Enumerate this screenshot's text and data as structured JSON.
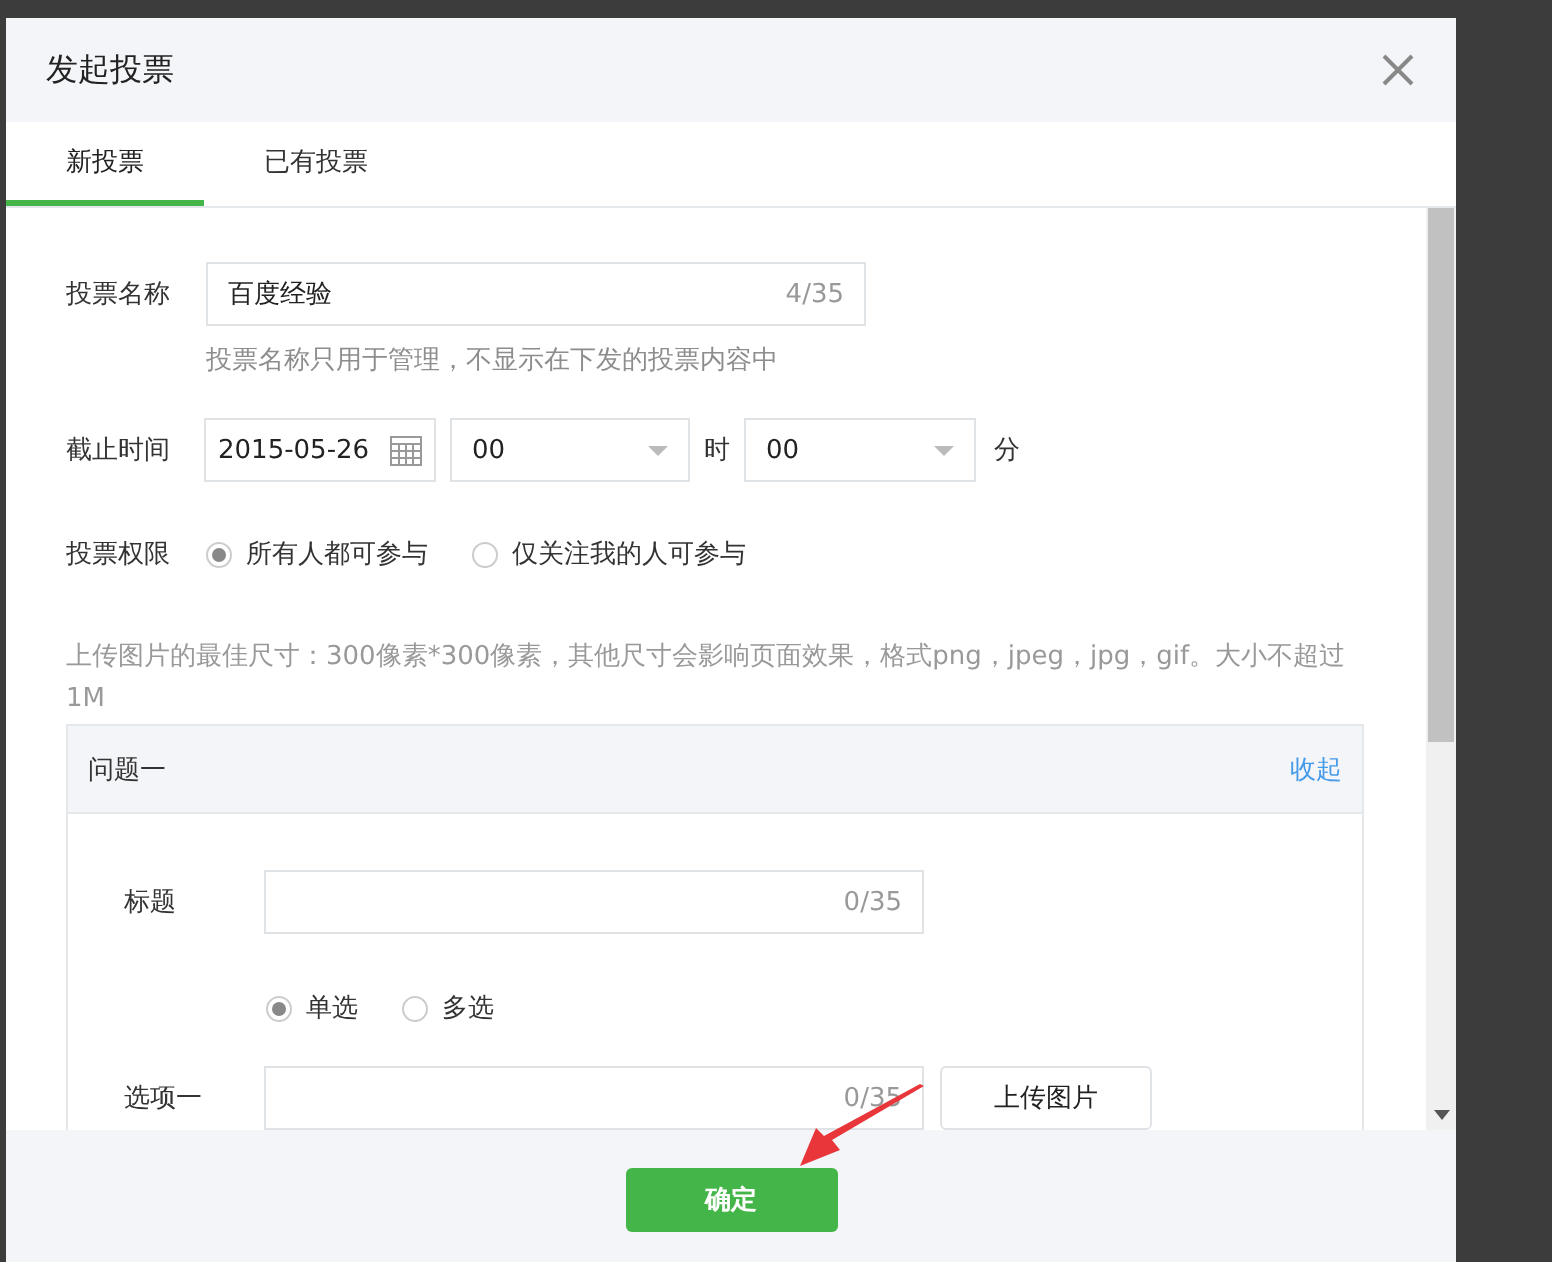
{
  "dialog": {
    "title": "发起投票"
  },
  "tabs": [
    {
      "label": "新投票",
      "selected": true
    },
    {
      "label": "已有投票",
      "selected": false
    }
  ],
  "vote_name": {
    "label": "投票名称",
    "value": "百度经验",
    "counter": "4/35",
    "hint": "投票名称只用于管理，不显示在下发的投票内容中"
  },
  "deadline": {
    "label": "截止时间",
    "date": "2015-05-26",
    "hour": "00",
    "hour_unit": "时",
    "minute": "00",
    "minute_unit": "分"
  },
  "permission": {
    "label": "投票权限",
    "options": [
      {
        "label": "所有人都可参与",
        "selected": true
      },
      {
        "label": "仅关注我的人可参与",
        "selected": false
      }
    ]
  },
  "upload_note": "上传图片的最佳尺寸：300像素*300像素，其他尺寸会影响页面效果，格式png，jpeg，jpg，gif。大小不超过1M",
  "question": {
    "header": "问题一",
    "collapse_link": "收起",
    "title_label": "标题",
    "title_counter": "0/35",
    "types": [
      {
        "label": "单选",
        "selected": true
      },
      {
        "label": "多选",
        "selected": false
      }
    ],
    "options": [
      {
        "label": "选项一",
        "counter": "0/35",
        "upload_button": "上传图片"
      }
    ]
  },
  "footer": {
    "confirm_button": "确定"
  }
}
